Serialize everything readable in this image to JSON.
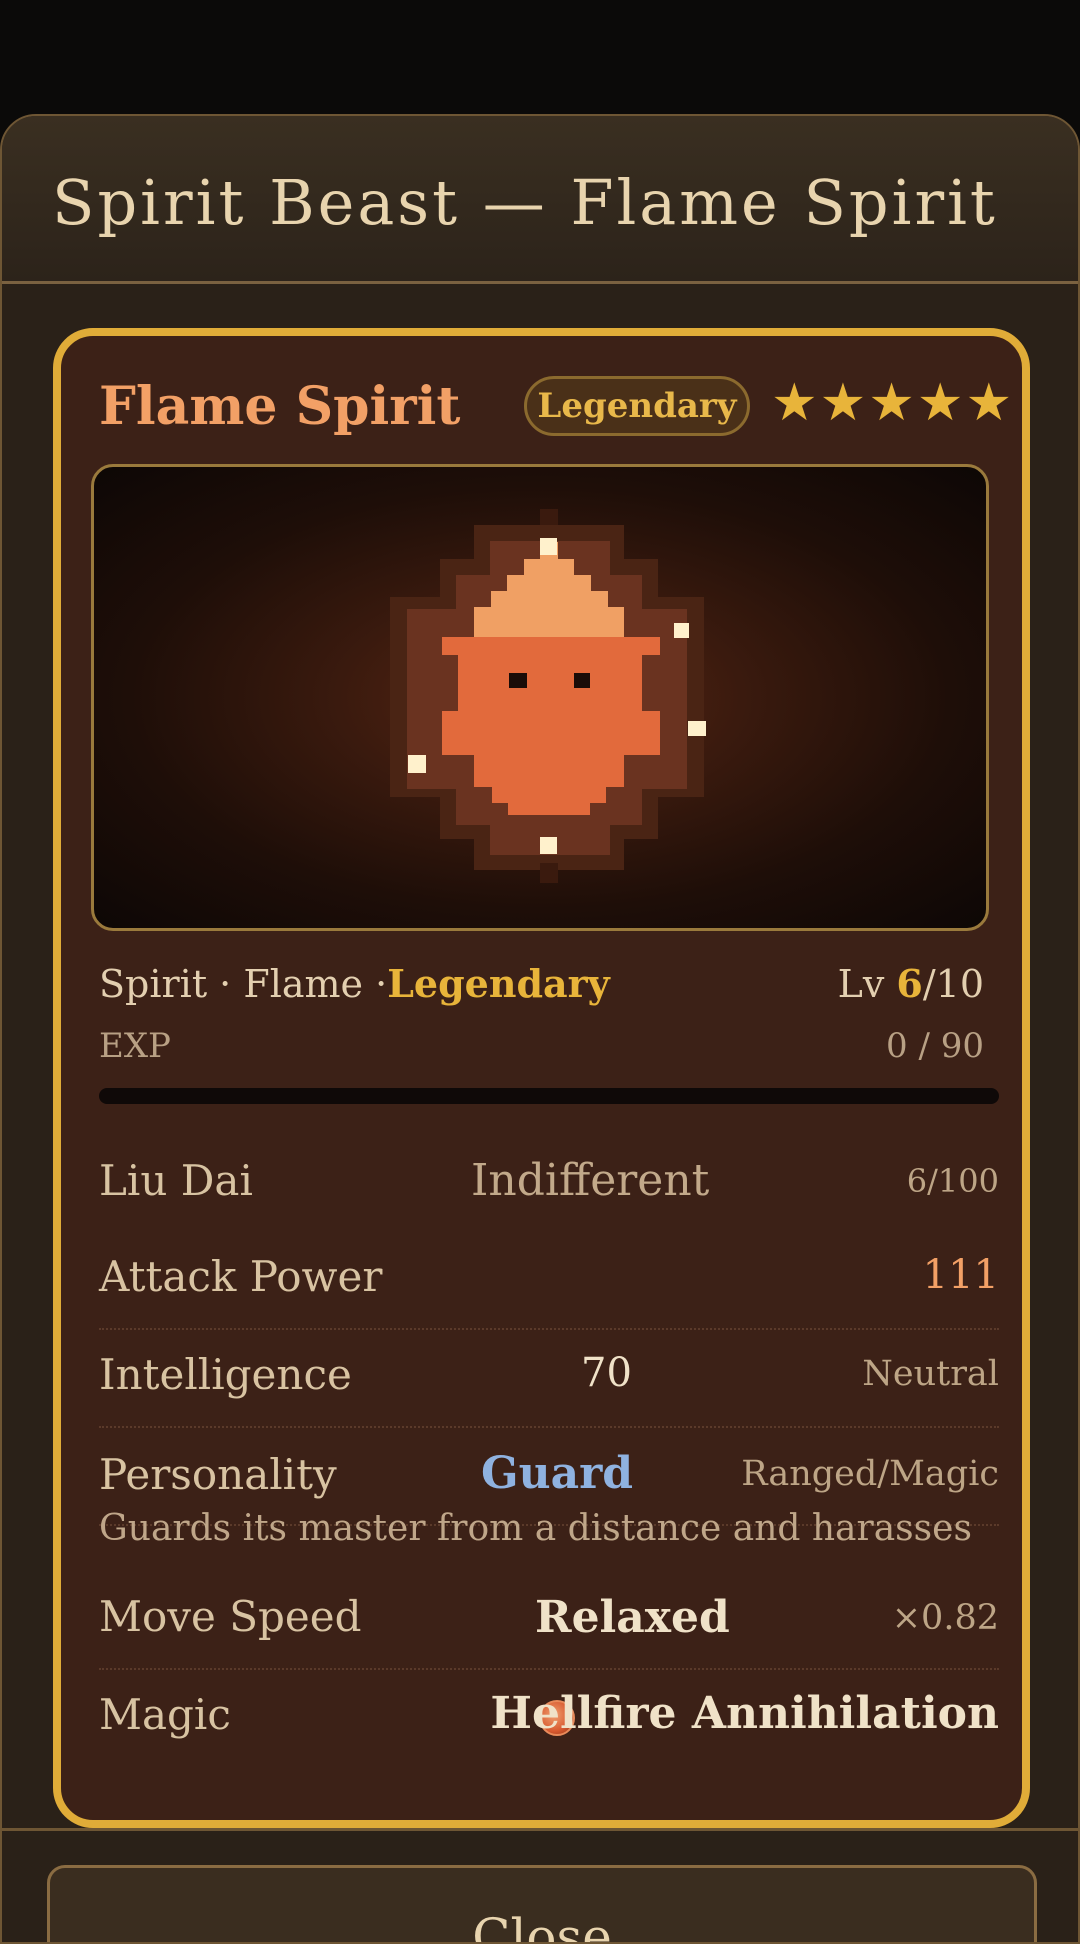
{
  "modal": {
    "title": "Spirit Beast — Flame Spirit"
  },
  "card": {
    "name": "Flame Spirit",
    "rarity_badge": "Legendary",
    "stars": [
      "★",
      "★",
      "★",
      "★",
      "★"
    ],
    "meta": {
      "type_prefix": "Spirit · Flame ·",
      "rarity": "Legendary",
      "level_label": "Lv ",
      "level_current": "6",
      "level_max": "/10"
    },
    "exp": {
      "label": "EXP",
      "value": "0 / 90",
      "fraction": 0
    },
    "stats": {
      "bond": {
        "label": "Liu Dai",
        "value": "Indifferent",
        "extra": "6/100"
      },
      "attack": {
        "label": "Attack Power",
        "value": "111"
      },
      "intelligence": {
        "label": "Intelligence",
        "value": "70",
        "extra": "Neutral"
      },
      "personality": {
        "label": "Personality",
        "value": "Guard",
        "extra": "Ranged/Magic"
      },
      "personality_desc": "Guards its master from a distance and harasses",
      "move_speed": {
        "label": "Move Speed",
        "value": "Relaxed",
        "extra": "×0.82"
      },
      "magic": {
        "label": "Magic",
        "value": "Hellfire Annihilation",
        "icon": "fire-orb-icon"
      }
    }
  },
  "footer": {
    "close_label": "Close"
  },
  "colors": {
    "accent_gold": "#e0ac38",
    "name_orange": "#f2a066",
    "attack_orange": "#f2a066",
    "personality_blue": "#8fb2e0"
  }
}
